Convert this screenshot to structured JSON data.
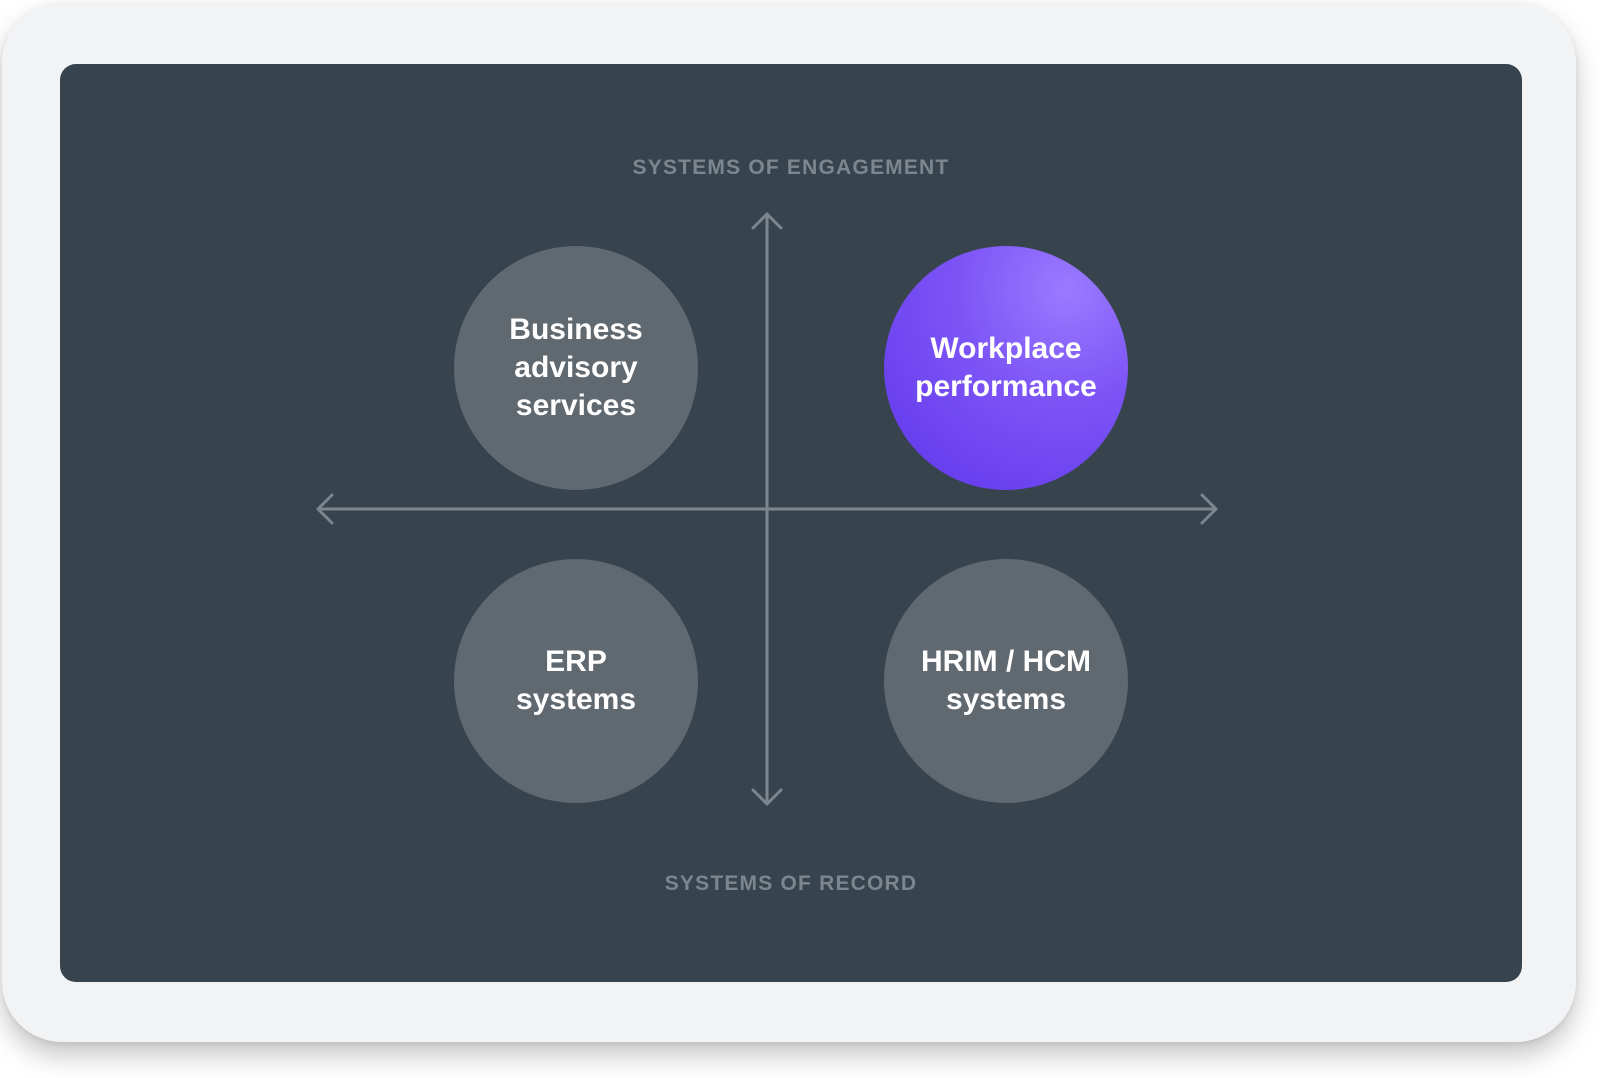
{
  "diagram": {
    "top_label": "SYSTEMS OF ENGAGEMENT",
    "bottom_label": "SYSTEMS OF RECORD",
    "quadrants": {
      "top_left": "Business\nadvisory\nservices",
      "top_right": "Workplace\nperformance",
      "bottom_left": "ERP\nsystems",
      "bottom_right": "HRIM / HCM\nsystems"
    },
    "colors": {
      "frame": "#f2f3f5",
      "screen": "#37444d",
      "bubble": "#606870",
      "highlight_start": "#9a7bff",
      "highlight_end": "#5f35ea",
      "axis": "#7c868e",
      "bubble_text": "#ffffff"
    }
  }
}
